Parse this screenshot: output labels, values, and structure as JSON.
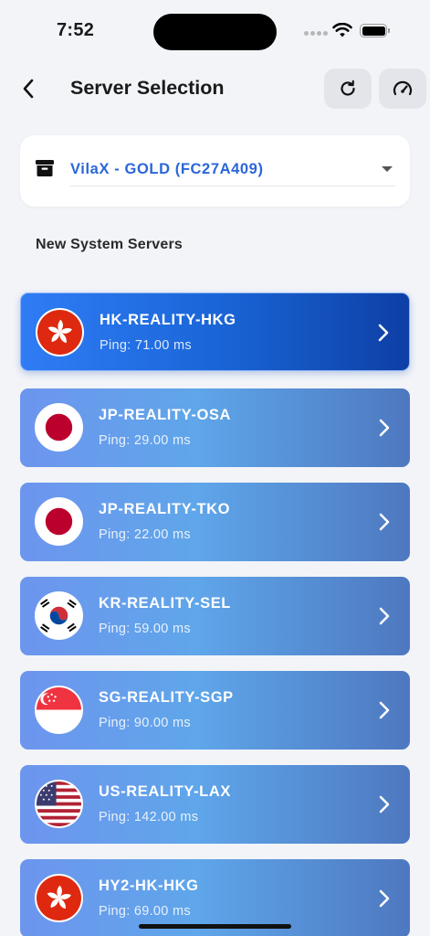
{
  "status_bar": {
    "time": "7:52"
  },
  "header": {
    "title": "Server Selection",
    "icons": {
      "back": "chevron-left-icon",
      "refresh": "refresh-icon",
      "speed": "speedometer-icon"
    }
  },
  "subscription": {
    "icon": "archive-box-icon",
    "selected": "VilaX - GOLD (FC27A409)"
  },
  "section_title": "New System Servers",
  "servers": [
    {
      "name": "HK-REALITY-HKG",
      "ping": "Ping: 71.00 ms",
      "flag": "hong-kong-flag-icon",
      "selected": true
    },
    {
      "name": "JP-REALITY-OSA",
      "ping": "Ping: 29.00 ms",
      "flag": "japan-flag-icon"
    },
    {
      "name": "JP-REALITY-TKO",
      "ping": "Ping: 22.00 ms",
      "flag": "japan-flag-icon"
    },
    {
      "name": "KR-REALITY-SEL",
      "ping": "Ping: 59.00 ms",
      "flag": "south-korea-flag-icon"
    },
    {
      "name": "SG-REALITY-SGP",
      "ping": "Ping: 90.00 ms",
      "flag": "singapore-flag-icon"
    },
    {
      "name": "US-REALITY-LAX",
      "ping": "Ping: 142.00 ms",
      "flag": "usa-flag-icon"
    },
    {
      "name": "HY2-HK-HKG",
      "ping": "Ping: 69.00 ms",
      "flag": "hong-kong-flag-icon"
    }
  ],
  "colors": {
    "accent": "#2B66D9",
    "selected_card": "#1A66D8",
    "card": "#5FA6EA",
    "background": "#F2F4F8"
  }
}
